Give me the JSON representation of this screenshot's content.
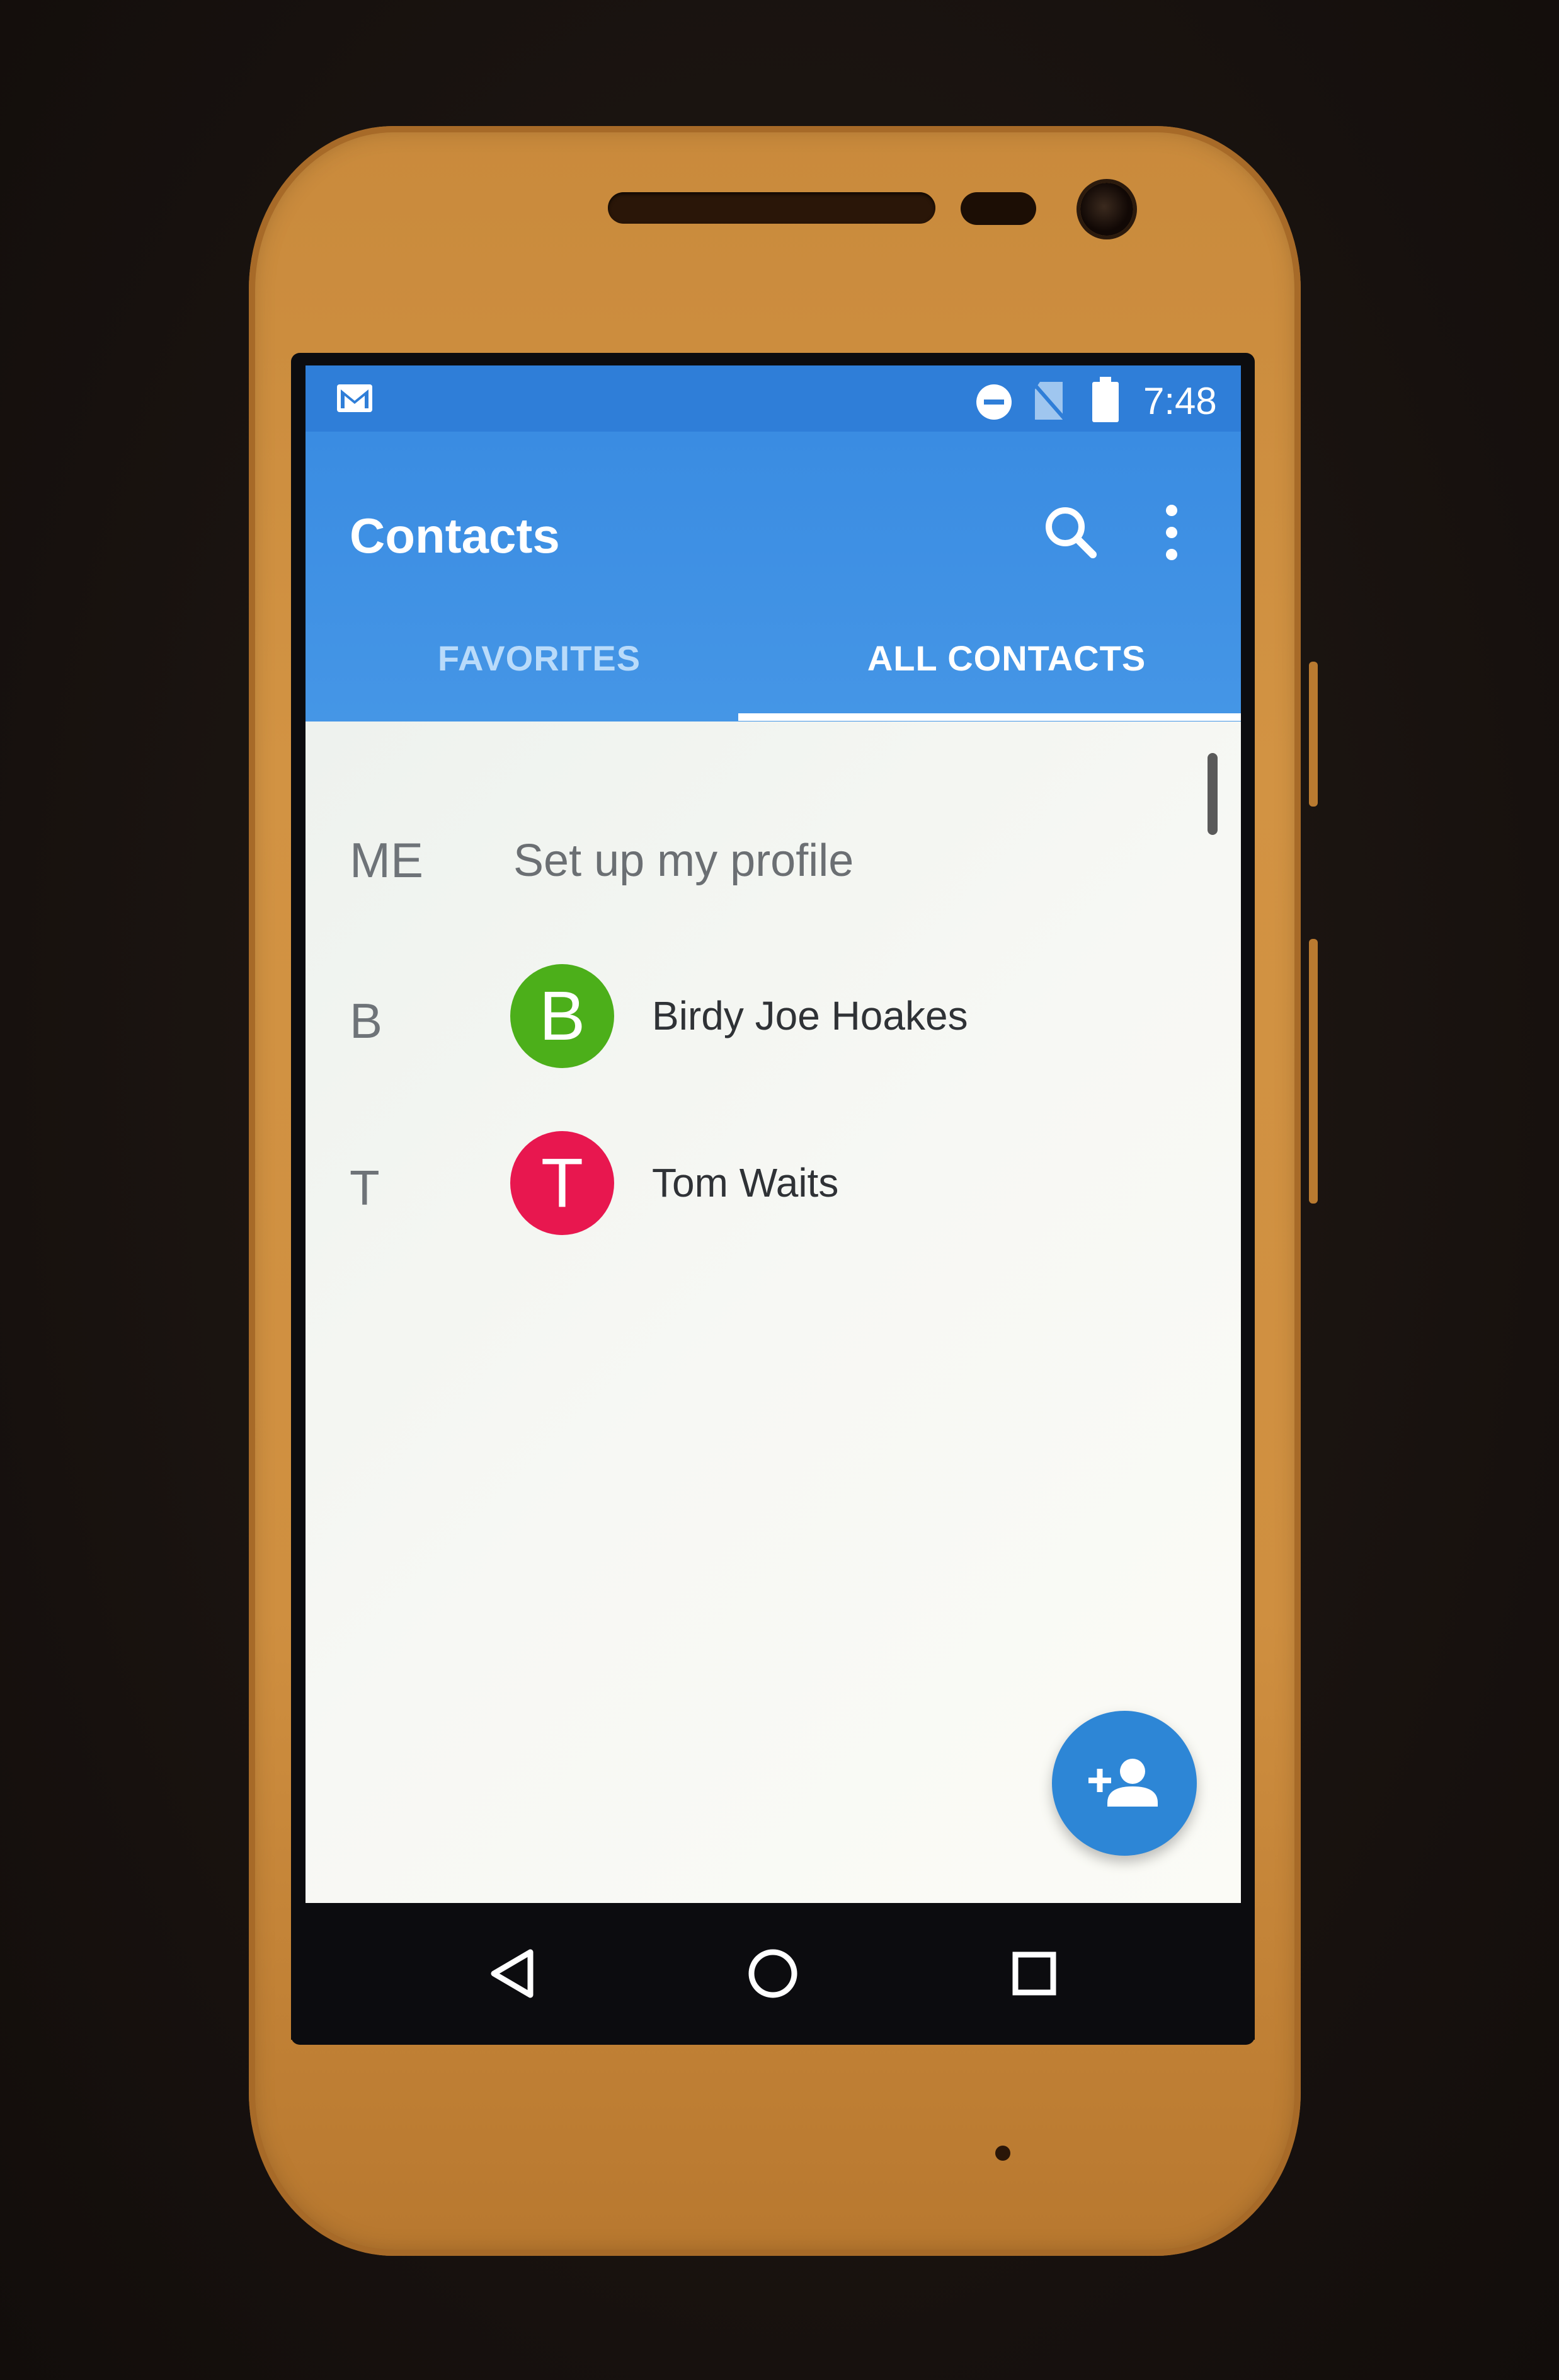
{
  "status_bar": {
    "time": "7:48",
    "icons": [
      "gmail-icon",
      "do-not-disturb-icon",
      "no-sim-icon",
      "battery-icon"
    ]
  },
  "app_bar": {
    "title": "Contacts",
    "actions": [
      "search-icon",
      "more-vert-icon"
    ]
  },
  "tabs": [
    {
      "label": "FAVORITES",
      "selected": false
    },
    {
      "label": "ALL CONTACTS",
      "selected": true
    }
  ],
  "me_section": {
    "letter": "ME",
    "label": "Set up my profile"
  },
  "contacts": [
    {
      "letter": "B",
      "initial": "B",
      "name": "Birdy Joe Hoakes",
      "avatar_color": "#4caf1a"
    },
    {
      "letter": "T",
      "initial": "T",
      "name": "Tom Waits",
      "avatar_color": "#e8174f"
    }
  ],
  "fab": {
    "icon": "add-person-icon"
  },
  "nav_bar": {
    "buttons": [
      "back-icon",
      "home-icon",
      "recents-icon"
    ]
  },
  "colors": {
    "primary": "#2f7ed8",
    "accent": "#2d86d6",
    "phone_body": "#d29343"
  }
}
